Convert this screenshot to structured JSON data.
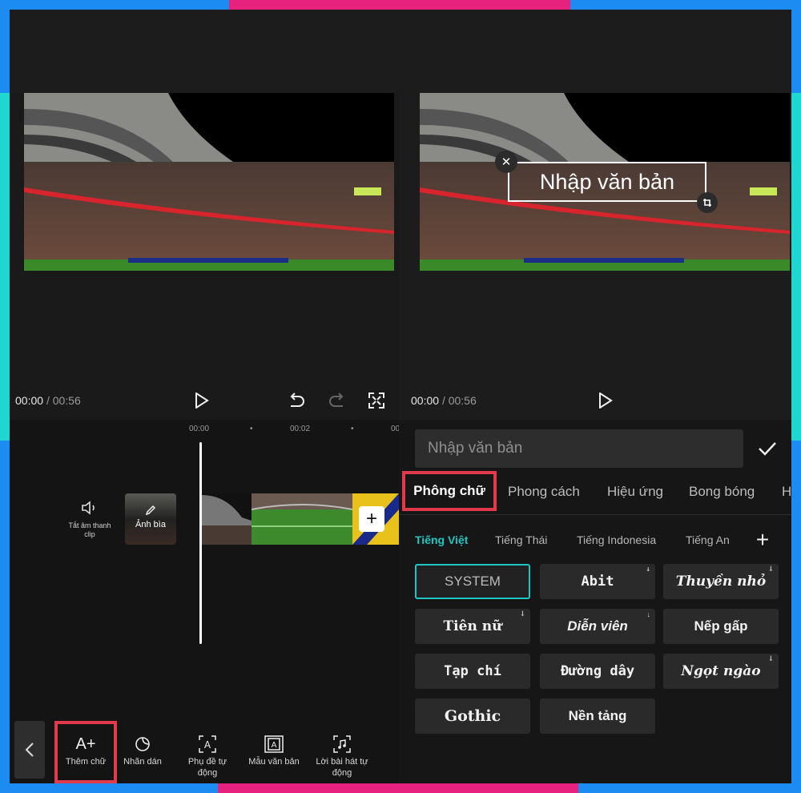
{
  "colors": {
    "accent_teal": "#1fc7c4",
    "highlight_red": "#e23a4a",
    "border_blue": "#1d8cf2",
    "border_pink": "#e6227e",
    "border_cyan": "#1fd6d0"
  },
  "left": {
    "time_current": "00:00",
    "time_total": "/ 00:56",
    "ruler": [
      "00:00",
      "00:02",
      "00"
    ],
    "mute_label": "Tắt âm thanh clip",
    "cover_label": "Ảnh bìa",
    "toolbar": [
      {
        "label": "Thêm chữ",
        "icon": "text-add-icon"
      },
      {
        "label": "Nhãn dán",
        "icon": "sticker-icon"
      },
      {
        "label": "Phụ đề tự động",
        "icon": "auto-caption-icon"
      },
      {
        "label": "Mẫu văn bản",
        "icon": "text-template-icon"
      },
      {
        "label": "Lời bài hát tự động",
        "icon": "auto-lyrics-icon"
      }
    ]
  },
  "right": {
    "time_current": "00:00",
    "time_total": "/ 00:56",
    "overlay_text": "Nhập văn bản",
    "input_placeholder": "Nhập văn bản",
    "tabs": [
      "Phông chữ",
      "Phong cách",
      "Hiệu ứng",
      "Bong bóng",
      "H"
    ],
    "languages": [
      "Tiếng Việt",
      "Tiếng Thái",
      "Tiếng Indonesia",
      "Tiếng An"
    ],
    "fonts": [
      {
        "name": "SYSTEM",
        "selected": true,
        "download": false
      },
      {
        "name": "Abit",
        "selected": false,
        "download": true
      },
      {
        "name": "Thuyền nhỏ",
        "selected": false,
        "download": true
      },
      {
        "name": "Tiên nữ",
        "selected": false,
        "download": true
      },
      {
        "name": "Diễn viên",
        "selected": false,
        "download": true
      },
      {
        "name": "Nếp gấp",
        "selected": false,
        "download": false
      },
      {
        "name": "Tạp chí",
        "selected": false,
        "download": false
      },
      {
        "name": "Đường dây",
        "selected": false,
        "download": false
      },
      {
        "name": "Ngọt ngào",
        "selected": false,
        "download": true
      },
      {
        "name": "Gothic",
        "selected": false,
        "download": false
      },
      {
        "name": "Nền tảng",
        "selected": false,
        "download": false
      }
    ]
  }
}
